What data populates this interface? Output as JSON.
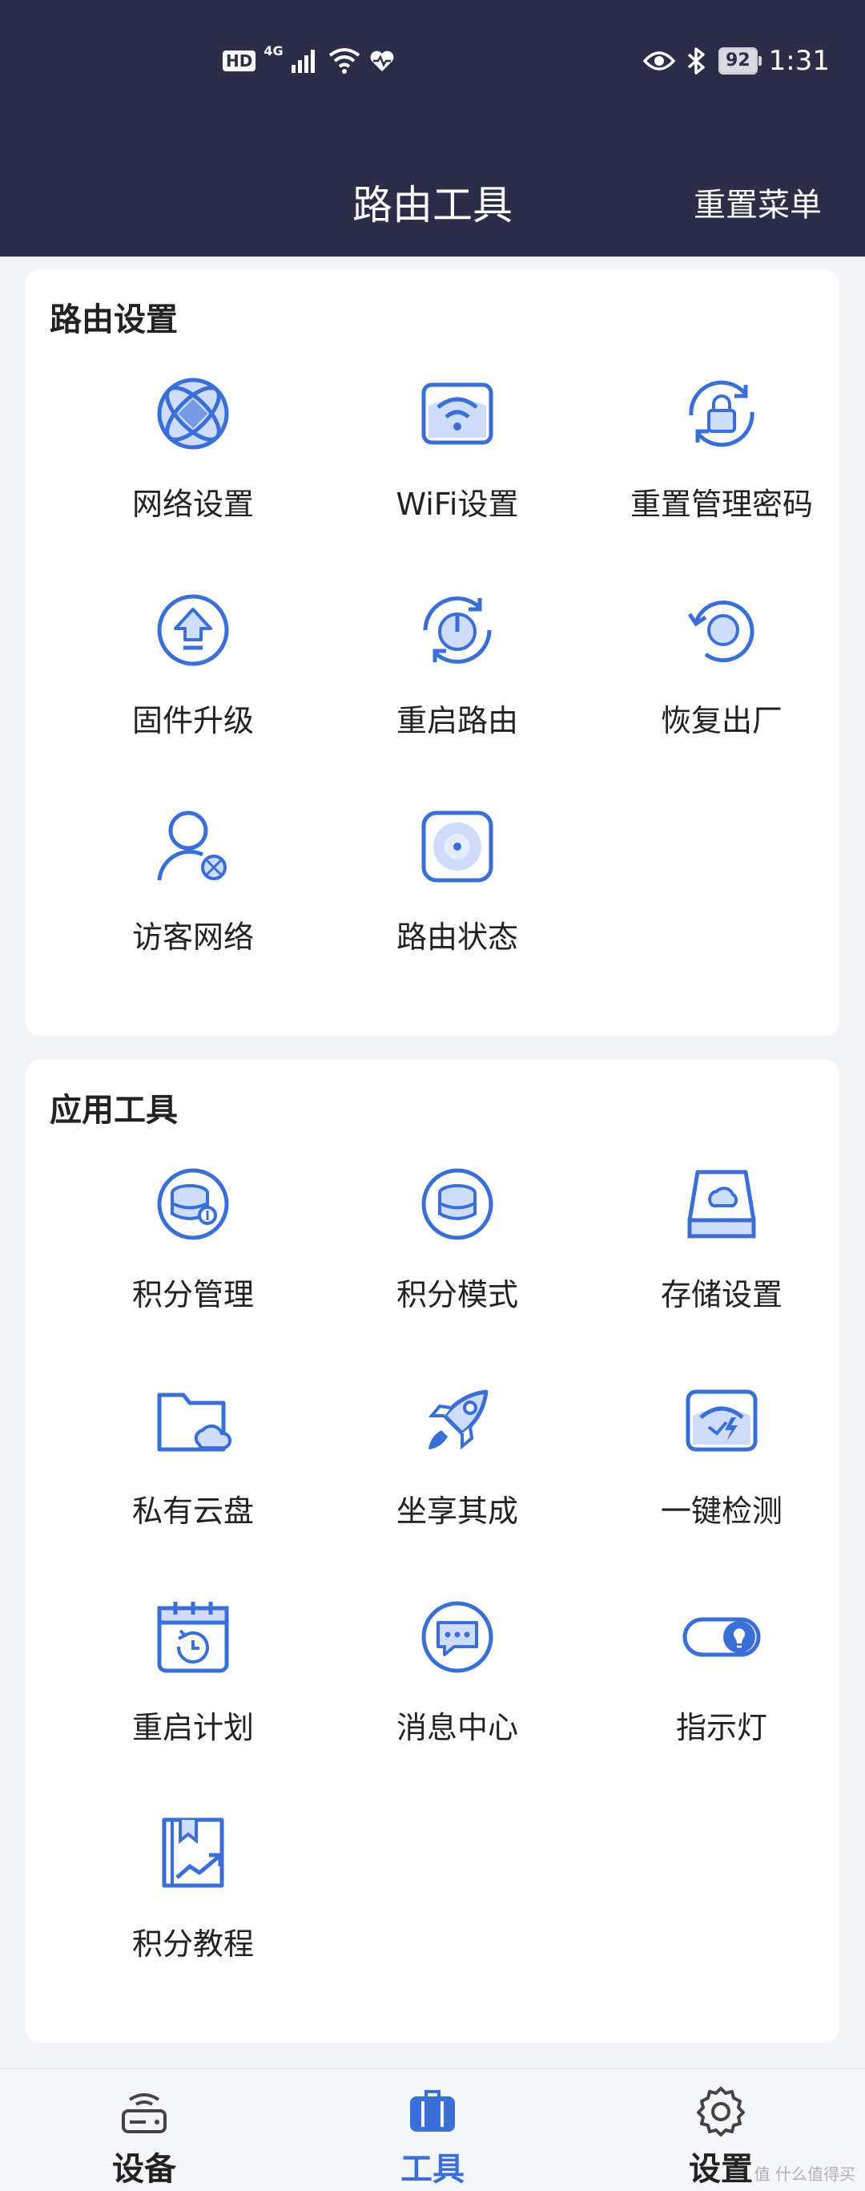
{
  "status_bar": {
    "hd": "HD",
    "network": "4G",
    "battery": "92",
    "time": "1:31"
  },
  "header": {
    "title": "路由工具",
    "reset_menu": "重置菜单"
  },
  "sections": [
    {
      "title": "路由设置",
      "items": [
        {
          "label": "网络设置",
          "icon": "globe-icon"
        },
        {
          "label": "WiFi设置",
          "icon": "wifi-icon"
        },
        {
          "label": "重置管理密码",
          "icon": "lock-refresh-icon"
        },
        {
          "label": "固件升级",
          "icon": "upgrade-icon"
        },
        {
          "label": "重启路由",
          "icon": "power-restart-icon"
        },
        {
          "label": "恢复出厂",
          "icon": "restore-icon"
        },
        {
          "label": "访客网络",
          "icon": "guest-user-icon"
        },
        {
          "label": "路由状态",
          "icon": "router-status-icon"
        }
      ]
    },
    {
      "title": "应用工具",
      "items": [
        {
          "label": "积分管理",
          "icon": "coins-manage-icon"
        },
        {
          "label": "积分模式",
          "icon": "coins-icon"
        },
        {
          "label": "存储设置",
          "icon": "storage-cloud-icon"
        },
        {
          "label": "私有云盘",
          "icon": "folder-cloud-icon"
        },
        {
          "label": "坐享其成",
          "icon": "rocket-icon"
        },
        {
          "label": "一键检测",
          "icon": "speed-check-icon"
        },
        {
          "label": "重启计划",
          "icon": "calendar-restart-icon"
        },
        {
          "label": "消息中心",
          "icon": "message-icon"
        },
        {
          "label": "指示灯",
          "icon": "light-toggle-icon"
        },
        {
          "label": "积分教程",
          "icon": "tutorial-book-icon"
        }
      ]
    }
  ],
  "tabbar": [
    {
      "label": "设备",
      "icon": "router-device-icon",
      "active": false
    },
    {
      "label": "工具",
      "icon": "toolbox-icon",
      "active": true
    },
    {
      "label": "设置",
      "icon": "gear-icon",
      "active": false
    }
  ],
  "watermark": "值 什么值得买",
  "colors": {
    "header_bg": "#2b2d49",
    "accent": "#3a6fd8",
    "icon_fill": "#cfdcfb",
    "page_bg": "#f3f4f8"
  }
}
